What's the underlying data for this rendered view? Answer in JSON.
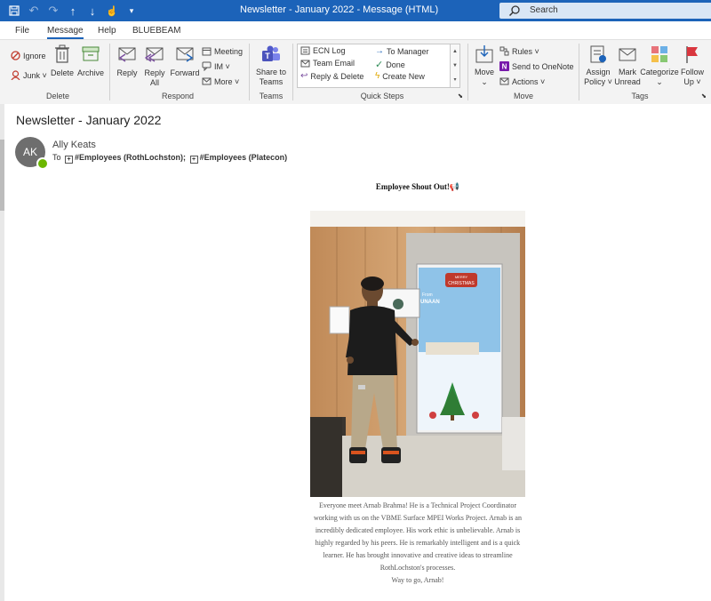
{
  "window": {
    "title": "Newsletter - January 2022  -  Message (HTML)",
    "search_placeholder": "Search"
  },
  "menu": {
    "tabs": [
      "File",
      "Message",
      "Help",
      "BLUEBEAM"
    ],
    "active_tab": "Message"
  },
  "ribbon": {
    "delete_group": {
      "label": "Delete",
      "ignore": "Ignore",
      "junk": "Junk ˅",
      "delete": "Delete",
      "archive": "Archive"
    },
    "respond_group": {
      "label": "Respond",
      "reply": "Reply",
      "reply_all_1": "Reply",
      "reply_all_2": "All",
      "forward": "Forward",
      "meeting": "Meeting",
      "im": "IM ˅",
      "more": "More ˅"
    },
    "teams_group": {
      "label": "Teams",
      "share_1": "Share to",
      "share_2": "Teams"
    },
    "quick_steps_group": {
      "label": "Quick Steps",
      "items": [
        "ECN Log",
        "To Manager",
        "Team Email",
        "Done",
        "Reply & Delete",
        "Create New"
      ]
    },
    "move_group": {
      "label": "Move",
      "move": "Move",
      "rules": "Rules ˅",
      "onenote": "Send to OneNote",
      "actions": "Actions ˅"
    },
    "tags_group": {
      "label": "Tags",
      "assign_1": "Assign",
      "assign_2": "Policy ˅",
      "mark_1": "Mark",
      "mark_2": "Unread",
      "categorize": "Categorize",
      "follow_1": "Follow",
      "follow_2": "Up ˅"
    }
  },
  "message": {
    "subject": "Newsletter - January 2022",
    "sender_initials": "AK",
    "sender_name": "Ally Keats",
    "to_label": "To",
    "recipients": [
      "#Employees (RothLochston);",
      "#Employees (Platecon)"
    ],
    "heading": "Employee Shout Out!📢",
    "caption_lines": [
      "Everyone meet Arnab Brahma! He is a Technical Project Coordinator",
      "working with us on the VBME Surface MPEI Works Project. Arnab is an",
      "incredibly dedicated employee. His work ethic is unbelievable. Arnab is",
      "highly regarded by his peers. He is remarkably intelligent and is a quick",
      "learner. He has brought innovative and creative ideas to streamline",
      "RothLochston's processes.",
      "Way to go, Arnab!"
    ],
    "door_sign_1": "MERRY",
    "door_sign_2": "CHRISTMAS",
    "door_from": "From",
    "door_team": "UNAAN"
  }
}
